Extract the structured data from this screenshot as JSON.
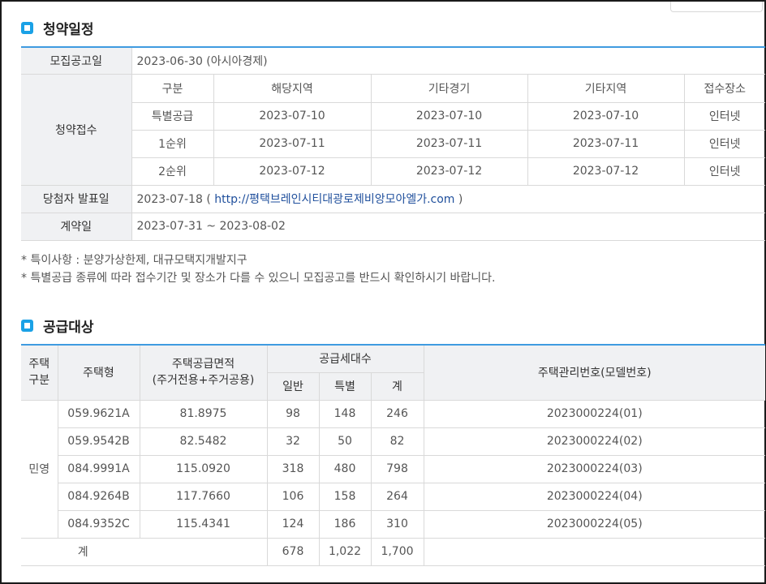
{
  "schedule": {
    "title": "청약일정",
    "announce_label": "모집공고일",
    "announce_value": "2023-06-30 (아시아경제)",
    "subscription_label": "청약접수",
    "sub_headers": [
      "구분",
      "해당지역",
      "기타경기",
      "기타지역",
      "접수장소"
    ],
    "sub_rows": [
      [
        "특별공급",
        "2023-07-10",
        "2023-07-10",
        "2023-07-10",
        "인터넷"
      ],
      [
        "1순위",
        "2023-07-11",
        "2023-07-11",
        "2023-07-11",
        "인터넷"
      ],
      [
        "2순위",
        "2023-07-12",
        "2023-07-12",
        "2023-07-12",
        "인터넷"
      ]
    ],
    "winner_label": "당첨자 발표일",
    "winner_date": "2023-07-18",
    "winner_open": "(",
    "winner_link": "http://평택브레인시티대광로제비앙모아엘가.com",
    "winner_close": ")",
    "contract_label": "계약일",
    "contract_value": "2023-07-31 ~ 2023-08-02"
  },
  "notes": [
    "* 특이사항 : 분양가상한제, 대규모택지개발지구",
    "* 특별공급 종류에 따라 접수기간 및 장소가 다를 수 있으니 모집공고를 반드시 확인하시기 바랍니다."
  ],
  "supply": {
    "title": "공급대상",
    "h_category_1": "주택",
    "h_category_2": "구분",
    "h_type": "주택형",
    "h_area_1": "주택공급면적",
    "h_area_2": "(주거전용+주거공용)",
    "h_units": "공급세대수",
    "h_general": "일반",
    "h_special": "특별",
    "h_sum": "계",
    "h_mgmt": "주택관리번호(모델번호)",
    "category": "민영",
    "rows": [
      [
        "059.9621A",
        "81.8975",
        "98",
        "148",
        "246",
        "2023000224(01)"
      ],
      [
        "059.9542B",
        "82.5482",
        "32",
        "50",
        "82",
        "2023000224(02)"
      ],
      [
        "084.9991A",
        "115.0920",
        "318",
        "480",
        "798",
        "2023000224(03)"
      ],
      [
        "084.9264B",
        "117.7660",
        "106",
        "158",
        "264",
        "2023000224(04)"
      ],
      [
        "084.9352C",
        "115.4341",
        "124",
        "186",
        "310",
        "2023000224(05)"
      ]
    ],
    "total_label": "계",
    "total_general": "678",
    "total_special": "1,022",
    "total_sum": "1,700"
  },
  "colors": {
    "accent": "#3f9be0",
    "icon": "#1aa1e6",
    "header_bg": "#f0f1f3",
    "link": "#1f4f9c"
  },
  "icons": {
    "section_icon": "square-bullet-icon"
  }
}
